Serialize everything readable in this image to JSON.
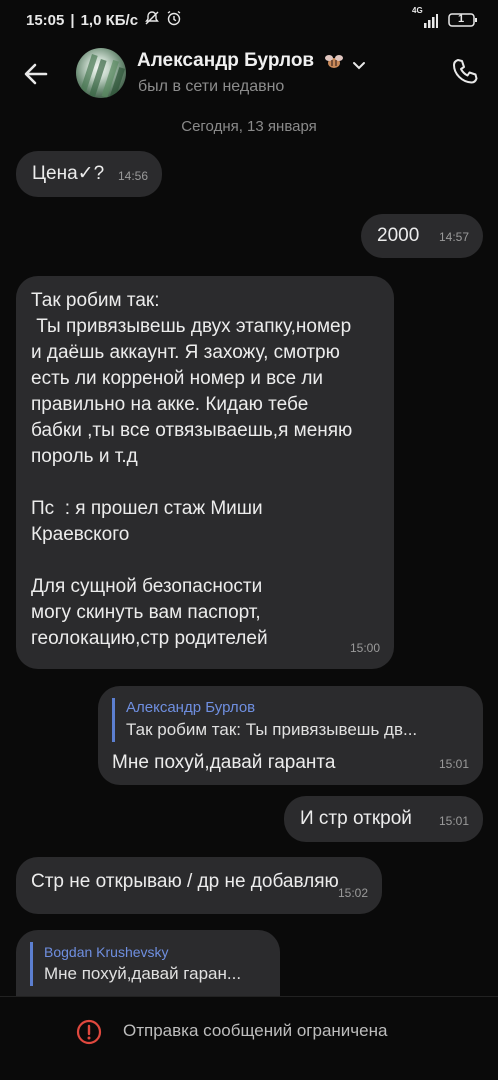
{
  "status_bar": {
    "time": "15:05",
    "speed": "1,0 КБ/с",
    "network": "4G",
    "battery": "1"
  },
  "header": {
    "contact_name": "Александр Бурлов",
    "contact_status": "был в сети недавно"
  },
  "date_separator": "Сегодня, 13 января",
  "messages": [
    {
      "id": "m1",
      "text": "Цена✓?",
      "time": "14:56"
    },
    {
      "id": "m2",
      "text": "2000",
      "time": "14:57"
    },
    {
      "id": "m3",
      "text": "Так робим так:\n Ты привязывешь двух этапку,номер\nи даёшь аккаунт. Я захожу, смотрю\nесть ли корреной номер и все ли\nправильно на акке. Кидаю тебе\nбабки ,ты все отвязываешь,я меняю\nпороль и т.д\n\nПс  : я прошел стаж Миши\nКраевского\n\nДля сущной безопасности\nмогу скинуть вам паспорт,\nгеолокацию,стр родителей",
      "time": "15:00"
    },
    {
      "id": "m4",
      "reply_author": "Александр Бурлов",
      "reply_snippet": "Так робим так:  Ты привязывешь дв...",
      "text": "Мне похуй,давай гаранта",
      "time": "15:01"
    },
    {
      "id": "m5",
      "text": "И стр открой",
      "time": "15:01"
    },
    {
      "id": "m6",
      "text": "Стр не открываю / др не добавляю",
      "time": "15:02"
    },
    {
      "id": "m7",
      "reply_author": "Bogdan Krushevsky",
      "reply_snippet": "Мне похуй,давай гаран..."
    }
  ],
  "footer": {
    "restricted_text": "Отправка сообщений ограничена"
  }
}
